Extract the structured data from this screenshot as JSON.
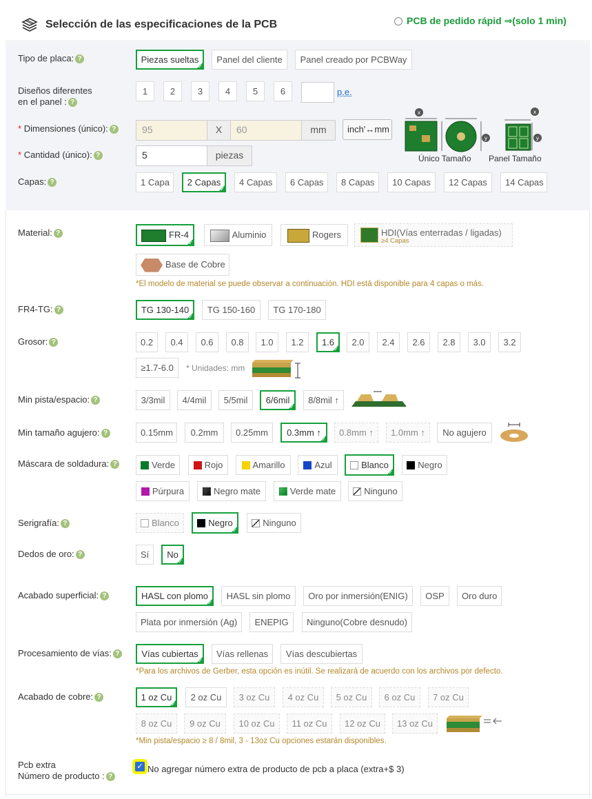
{
  "header": {
    "title": "Selección de las especificaciones de la PCB",
    "quick_order": "PCB de pedido rápid ⇒(solo 1 min)"
  },
  "help_glyph": "?",
  "board_type": {
    "label": "Tipo de placa:",
    "options": [
      "Piezas sueltas",
      "Panel del cliente",
      "Panel creado por PCBWay"
    ],
    "selected": "Piezas sueltas"
  },
  "designs": {
    "label_line1": "Diseños diferentes",
    "label_line2": "en el panel :",
    "options": [
      "1",
      "2",
      "3",
      "4",
      "5",
      "6"
    ],
    "custom_value": "",
    "example_link": "p.e."
  },
  "dimensions": {
    "label": "Dimensiones (único):",
    "required_mark": "*",
    "width": "95",
    "separator": "X",
    "height": "60",
    "unit": "mm",
    "convert_button": "inch'↔mm",
    "single_size_label": "Único Tamaño",
    "panel_size_label": "Panel Tamaño"
  },
  "quantity": {
    "label": "Cantidad (único):",
    "required_mark": "*",
    "value": "5",
    "unit": "piezas"
  },
  "layers": {
    "label": "Capas:",
    "options": [
      "1 Capa",
      "2 Capas",
      "4 Capas",
      "6 Capas",
      "8 Capas",
      "10 Capas",
      "12 Capas",
      "14 Capas"
    ],
    "selected": "2 Capas"
  },
  "material": {
    "label": "Material:",
    "options": [
      "FR-4",
      "Aluminio",
      "Rogers",
      "HDI(Vías enterradas / ligadas)",
      "Base de Cobre"
    ],
    "hdi_sub": "≥4 Capas",
    "selected": "FR-4",
    "note": "*El modelo de material se puede observar a continuación. HDI está disponible para 4 capas o más."
  },
  "fr4_tg": {
    "label": "FR4-TG:",
    "options": [
      "TG 130-140",
      "TG 150-160",
      "TG 170-180"
    ],
    "selected": "TG 130-140"
  },
  "thickness": {
    "label": "Grosor:",
    "options": [
      "0.2",
      "0.4",
      "0.6",
      "0.8",
      "1.0",
      "1.2",
      "1.6",
      "2.0",
      "2.4",
      "2.6",
      "2.8",
      "3.0",
      "3.2",
      "≥1.7-6.0"
    ],
    "selected": "1.6",
    "units_note": "* Unidades: mm"
  },
  "min_track": {
    "label": "Min pista/espacio:",
    "options": [
      "3/3mil",
      "4/4mil",
      "5/5mil",
      "6/6mil",
      "8/8mil ↑"
    ],
    "selected": "6/6mil"
  },
  "min_hole": {
    "label": "Min tamaño agujero:",
    "options": [
      "0.15mm",
      "0.2mm",
      "0.25mm",
      "0.3mm ↑",
      "0.8mm ↑",
      "1.0mm ↑",
      "No agujero"
    ],
    "selected": "0.3mm ↑"
  },
  "solder_mask": {
    "label": "Máscara de soldadura:",
    "options": [
      {
        "name": "Verde",
        "color": "#0a7a2a"
      },
      {
        "name": "Rojo",
        "color": "#d01515"
      },
      {
        "name": "Amarillo",
        "color": "#f6d200"
      },
      {
        "name": "Azul",
        "color": "#1446c8"
      },
      {
        "name": "Blanco",
        "color": "#ffffff"
      },
      {
        "name": "Negro",
        "color": "#000000"
      },
      {
        "name": "Púrpura",
        "color": "#b01aa8"
      },
      {
        "name": "Negro mate",
        "color": "#222222"
      },
      {
        "name": "Verde mate",
        "color": "#1f9e3a"
      },
      {
        "name": "Ninguno",
        "color": "none"
      }
    ],
    "selected": "Blanco"
  },
  "silkscreen": {
    "label": "Serigrafía:",
    "options": [
      {
        "name": "Blanco",
        "color": "#ffffff"
      },
      {
        "name": "Negro",
        "color": "#000000"
      },
      {
        "name": "Ninguno",
        "color": "none"
      }
    ],
    "selected": "Negro"
  },
  "gold_fingers": {
    "label": "Dedos de oro:",
    "options": [
      "Sí",
      "No"
    ],
    "selected": "No"
  },
  "surface_finish": {
    "label": "Acabado superficial:",
    "options": [
      "HASL con plomo",
      "HASL sin plomo",
      "Oro por inmersión(ENIG)",
      "OSP",
      "Oro duro",
      "Plata por inmersión (Ag)",
      "ENEPIG",
      "Ninguno(Cobre desnudo)"
    ],
    "selected": "HASL con plomo"
  },
  "via_process": {
    "label": "Procesamiento de vías:",
    "options": [
      "Vías cubiertas",
      "Vías rellenas",
      "Vías descubiertas"
    ],
    "selected": "Vías cubiertas",
    "note": "*Para los archivos de Gerber, esta opción es inútil. Se realizará de acuerdo con los archivos por defecto."
  },
  "copper": {
    "label": "Acabado de cobre:",
    "options": [
      "1 oz Cu",
      "2 oz Cu",
      "3 oz Cu",
      "4 oz Cu",
      "5 oz Cu",
      "6 oz Cu",
      "7 oz Cu",
      "8 oz Cu",
      "9 oz Cu",
      "10 oz Cu",
      "11 oz Cu",
      "12 oz Cu",
      "13 oz Cu"
    ],
    "selected": "1 oz Cu",
    "note": "*Min pista/espacio ≥ 8 / 8mil, 3 - 13oz Cu opciones estarán disponibles."
  },
  "extra_number": {
    "label_line1": "Pcb extra",
    "label_line2": "Número de producto :",
    "checkbox_label": "No agregar número extra de producto de pcb a placa (extra+$ 3)",
    "checked": true
  },
  "colors": {
    "accent_green": "#15a03c",
    "note_gold": "#b5872a",
    "required_red": "#e2231a",
    "link_blue": "#1a6ed0",
    "highlight_yellow": "#f6f205"
  }
}
